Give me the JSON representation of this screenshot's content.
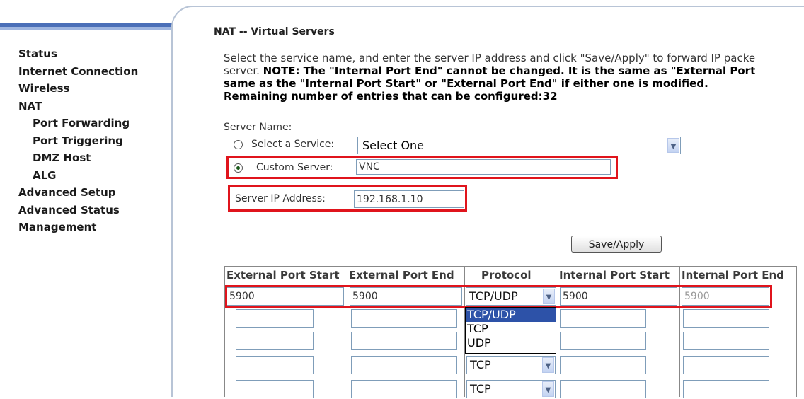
{
  "nav": {
    "items": [
      {
        "label": "Status",
        "sub": false
      },
      {
        "label": "Internet Connection",
        "sub": false
      },
      {
        "label": "Wireless",
        "sub": false
      },
      {
        "label": "NAT",
        "sub": false
      },
      {
        "label": "Port Forwarding",
        "sub": true
      },
      {
        "label": "Port Triggering",
        "sub": true
      },
      {
        "label": "DMZ Host",
        "sub": true
      },
      {
        "label": "ALG",
        "sub": true
      },
      {
        "label": "Advanced Setup",
        "sub": false
      },
      {
        "label": "Advanced Status",
        "sub": false
      },
      {
        "label": "Management",
        "sub": false
      }
    ]
  },
  "page": {
    "title": "NAT -- Virtual Servers",
    "desc_line1": "Select the service name, and enter the server IP address and click \"Save/Apply\" to forward IP packe",
    "desc_line2_a": "server. ",
    "desc_line2_b": "NOTE: The \"Internal Port End\" cannot be changed. It is the same as \"External Port",
    "desc_line3": "same as the \"Internal Port Start\" or \"External Port End\" if either one is modified.",
    "desc_line4": "Remaining number of entries that can be configured:32"
  },
  "form": {
    "server_name_label": "Server Name:",
    "select_service_label": "Select a Service:",
    "select_service_value": "Select One",
    "custom_server_label": "Custom Server:",
    "custom_server_value": "VNC",
    "server_ip_label": "Server IP Address:",
    "server_ip_value": "192.168.1.10",
    "save_button": "Save/Apply"
  },
  "table": {
    "headers": [
      "External Port Start",
      "External Port End",
      "Protocol",
      "Internal Port Start",
      "Internal Port End"
    ],
    "row1": {
      "ext_start": "5900",
      "ext_end": "5900",
      "protocol": "TCP/UDP",
      "int_start": "5900",
      "int_end": "5900"
    },
    "protocol_options": [
      "TCP/UDP",
      "TCP",
      "UDP"
    ],
    "row4_protocol": "TCP",
    "row5_protocol": "TCP"
  },
  "colors": {
    "highlight": "#e0141c",
    "selected_option": "#2d52a8"
  }
}
